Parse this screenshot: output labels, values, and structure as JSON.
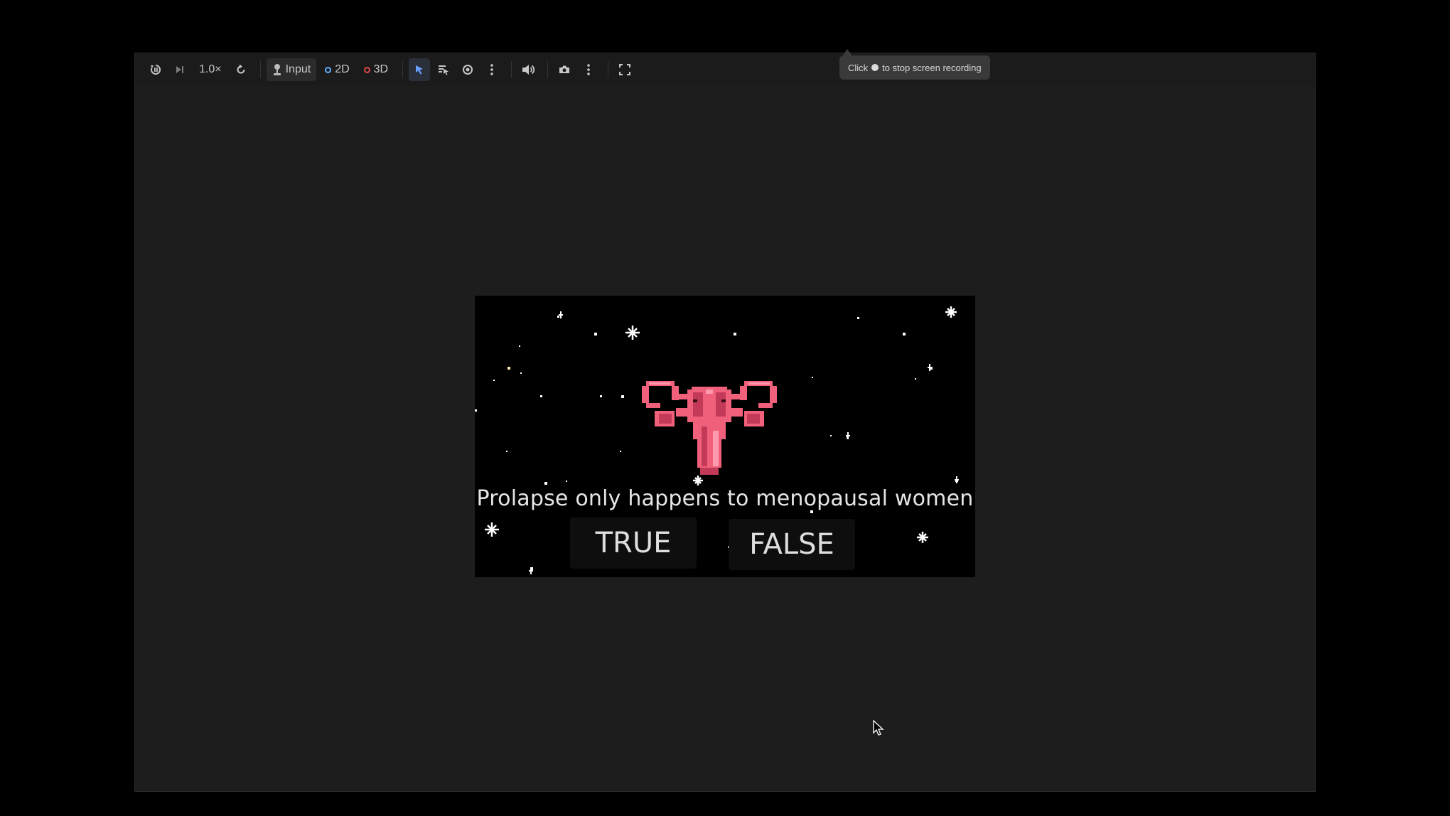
{
  "toolbar": {
    "speed_label": "1.0×",
    "input_label": "Input",
    "mode_2d_label": "2D",
    "mode_3d_label": "3D",
    "colors": {
      "mode_2d": "#5fb0ff",
      "mode_3d": "#e04848",
      "select_active": "#6aa0ff"
    }
  },
  "recording_tooltip": {
    "prefix": "Click",
    "suffix": "to stop screen recording"
  },
  "game": {
    "question": "Prolapse only happens to menopausal women",
    "answers": {
      "true_label": "TRUE",
      "false_label": "FALSE"
    },
    "colors": {
      "background": "#000000",
      "uterus_main": "#f0607a",
      "uterus_dark": "#c23a58",
      "uterus_light": "#ff9aae"
    }
  }
}
